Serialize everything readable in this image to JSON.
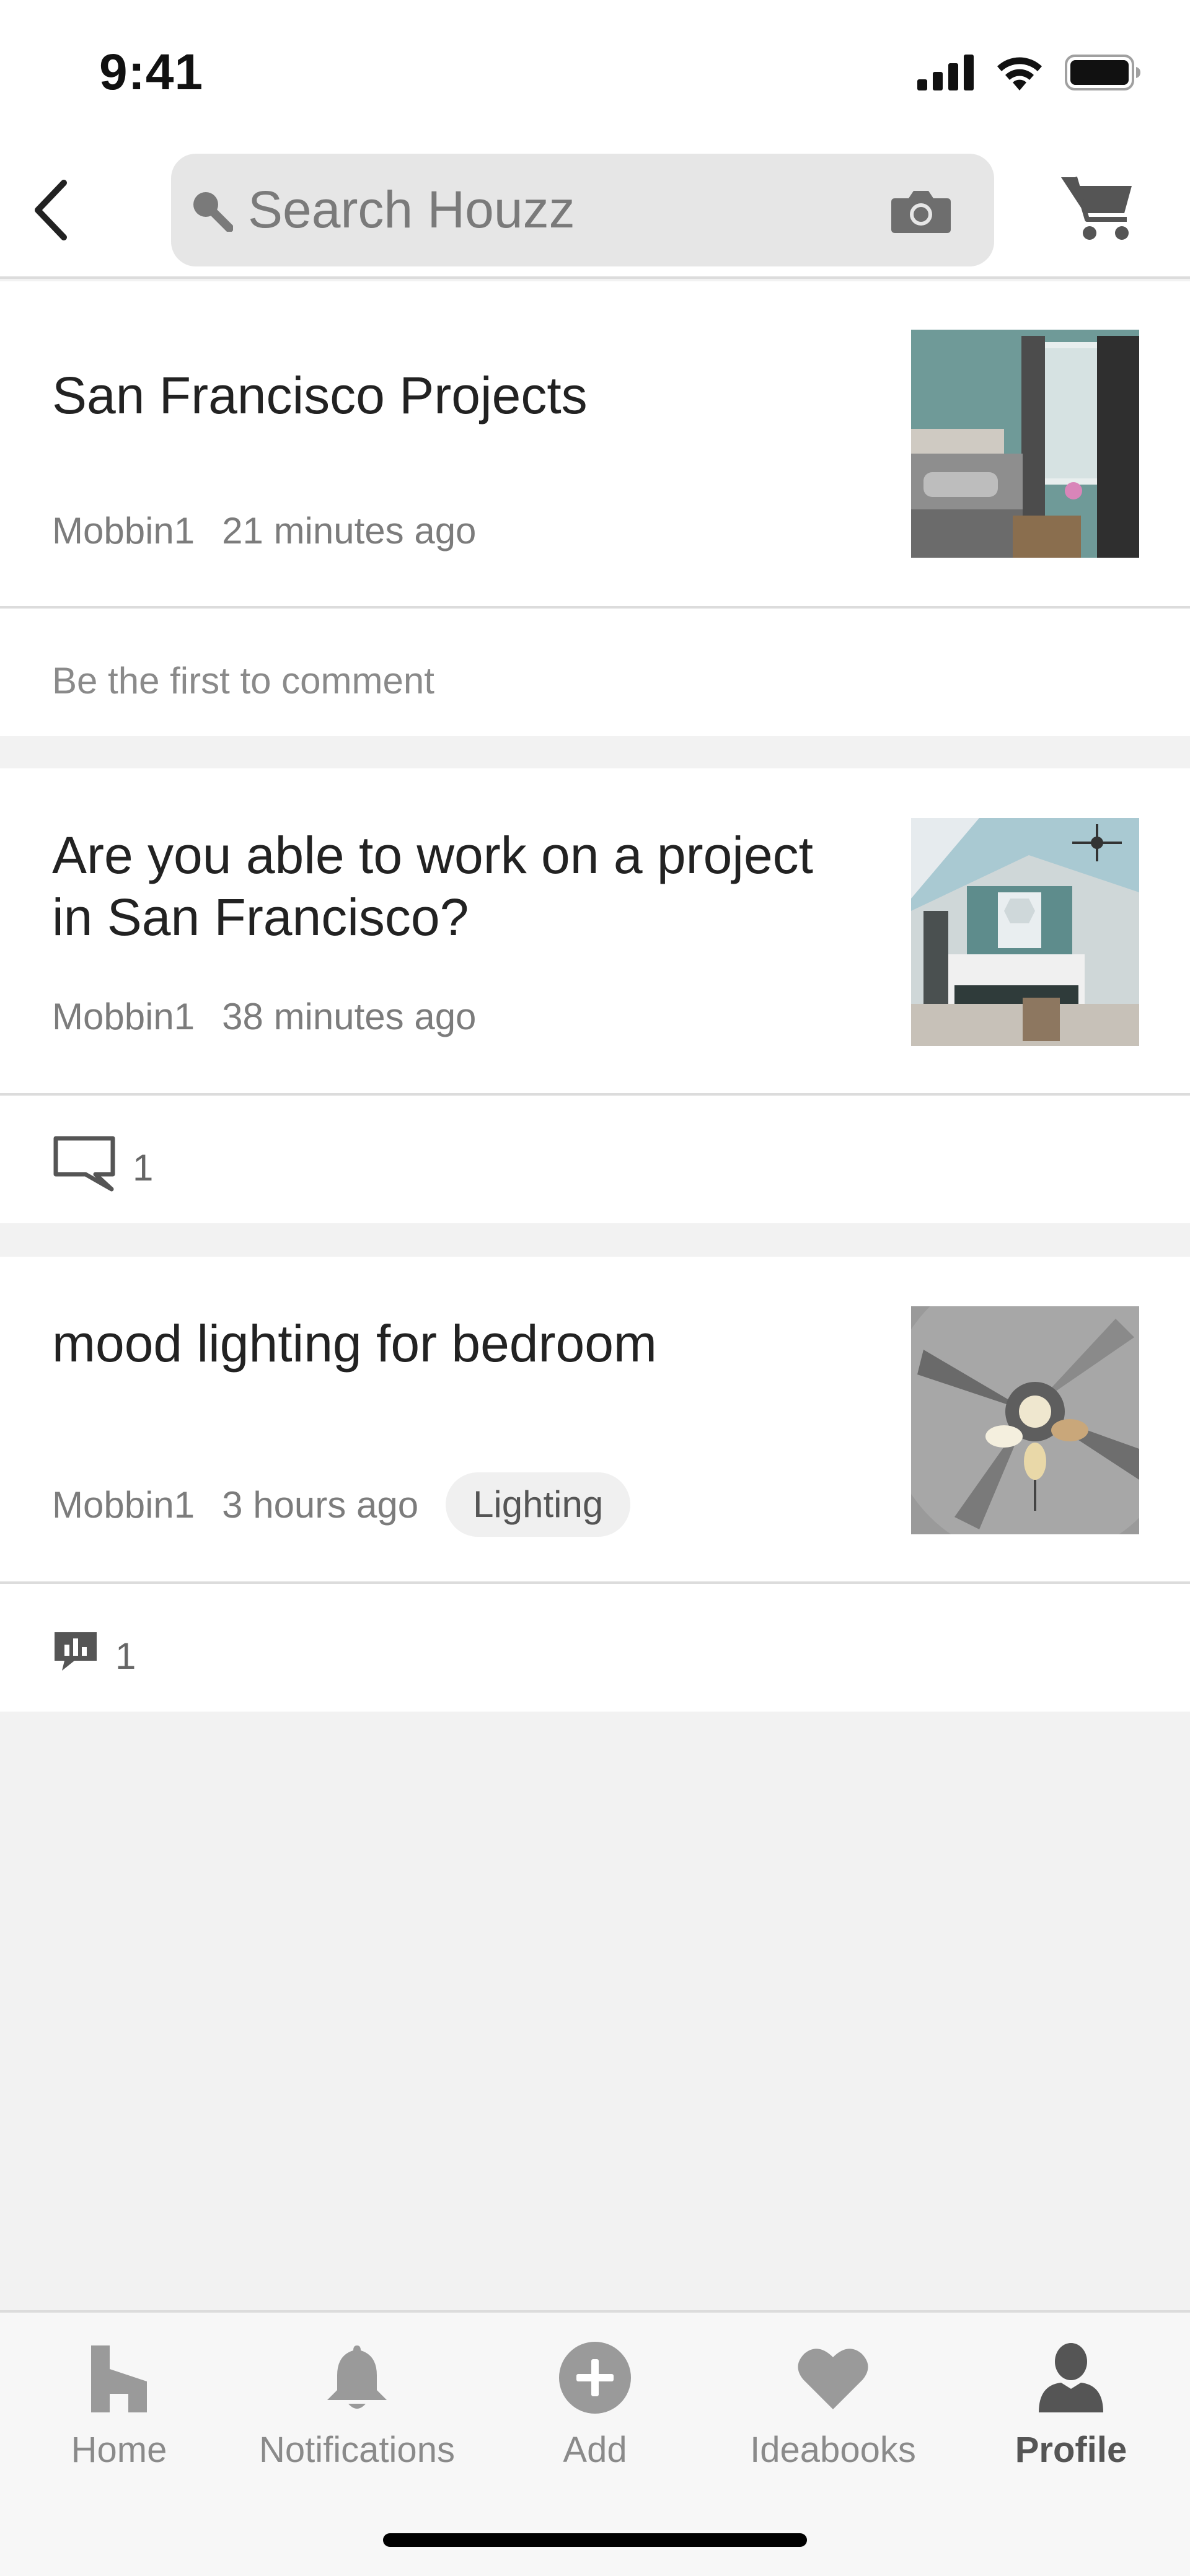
{
  "status": {
    "time": "9:41"
  },
  "header": {
    "search_placeholder": "Search Houzz"
  },
  "posts": [
    {
      "title": "San Francisco Projects",
      "author": "Mobbin1",
      "time_ago": "21 minutes ago",
      "thumbnail_icon": "bedroom-photo",
      "footer_text": "Be the first to comment"
    },
    {
      "title_line1": "Are you able to work on a project",
      "title_line2": "in San Francisco?",
      "author": "Mobbin1",
      "time_ago": "38 minutes ago",
      "thumbnail_icon": "attic-bedroom-photo",
      "comment_count": "1"
    },
    {
      "title": "mood lighting for bedroom",
      "author": "Mobbin1",
      "time_ago": "3 hours ago",
      "tag": "Lighting",
      "thumbnail_icon": "ceiling-fan-photo",
      "poll_count": "1"
    }
  ],
  "tabbar": {
    "items": [
      {
        "label": "Home",
        "icon": "home-icon"
      },
      {
        "label": "Notifications",
        "icon": "bell-icon"
      },
      {
        "label": "Add",
        "icon": "plus-circle-icon"
      },
      {
        "label": "Ideabooks",
        "icon": "heart-icon"
      },
      {
        "label": "Profile",
        "icon": "person-icon",
        "active": true
      }
    ]
  },
  "colors": {
    "background": "#f2f2f2",
    "card": "#ffffff",
    "text_primary": "#222222",
    "text_secondary": "#7c7c7c",
    "search_bg": "#e6e6e6"
  }
}
